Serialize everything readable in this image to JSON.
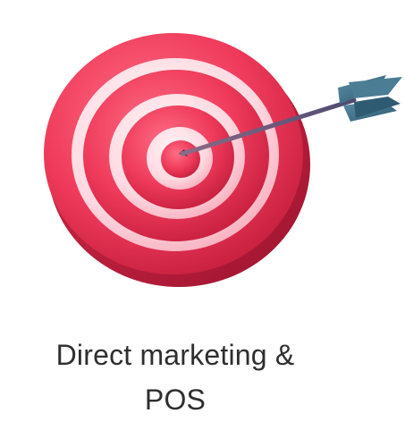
{
  "card": {
    "caption_line1": "Direct marketing &",
    "caption_line2": "POS"
  },
  "illustration": {
    "icon": "target-with-arrow-icon",
    "colors": {
      "target_red": "#ef3a5b",
      "target_pink": "#ffd9e1",
      "arrow_shaft": "#6a5a7e",
      "fletching": "#3c6d86"
    }
  }
}
